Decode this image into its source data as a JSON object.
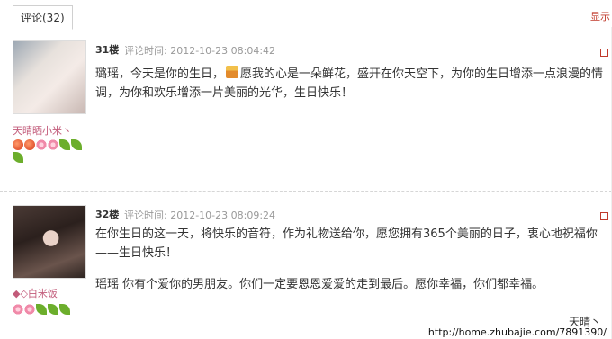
{
  "tabs": {
    "comments_label": "评论(32)"
  },
  "header": {
    "show_link": "显示"
  },
  "comments": [
    {
      "floor": "31楼",
      "time": "评论时间: 2012-10-23 08:04:42",
      "username": "天晴晒小米丶",
      "text_before_icon": "璐瑶，今天是你的生日，",
      "icon": "cake-icon",
      "text_after_icon": "愿我的心是一朵鲜花，盛开在你天空下，为你的生日增添一点浪漫的情调，为你和欢乐增添一片美丽的光华，生日快乐！",
      "badges": [
        "apple-badge",
        "apple-badge",
        "flower-badge",
        "flower-badge",
        "leaf-badge",
        "leaf-badge",
        "leaf-badge"
      ]
    },
    {
      "floor": "32楼",
      "time": "评论时间: 2012-10-23 08:09:24",
      "username": "◆◇白米饭",
      "paragraph1": "在你生日的这一天，将快乐的音符，作为礼物送给你，愿您拥有365个美丽的日子，衷心地祝福你——生日快乐！",
      "paragraph2": "瑶瑶  你有个爱你的男朋友。你们一定要恩恩爱爱的走到最后。愿你幸福，你们都幸福。",
      "badges": [
        "flower-badge",
        "flower-badge",
        "leaf-badge",
        "leaf-badge",
        "leaf-badge"
      ]
    }
  ],
  "footer": {
    "signature": "天晴丶",
    "watermark_url": "http://home.zhubajie.com/7891390/"
  }
}
